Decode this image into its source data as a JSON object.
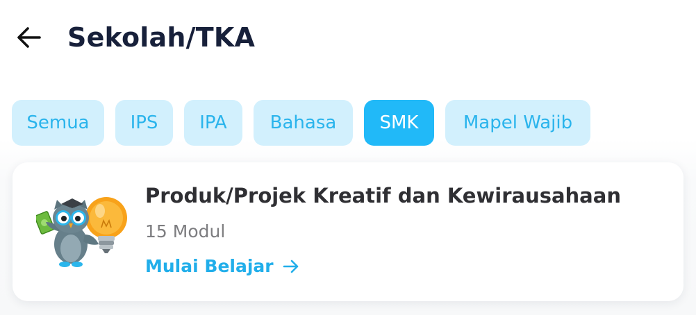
{
  "header": {
    "title": "Sekolah/TKA",
    "back_icon": "arrow-left-icon"
  },
  "filters": {
    "items": [
      {
        "label": "Semua",
        "active": false
      },
      {
        "label": "IPS",
        "active": false
      },
      {
        "label": "IPA",
        "active": false
      },
      {
        "label": "Bahasa",
        "active": false
      },
      {
        "label": "SMK",
        "active": true
      },
      {
        "label": "Mapel Wajib",
        "active": false
      }
    ]
  },
  "course": {
    "title": "Produk/Projek Kreatif dan Kewirausahaan",
    "modules": "15 Modul",
    "cta_label": "Mulai Belajar",
    "cta_icon": "arrow-right-icon",
    "illustration": "owl-lightbulb-money-illustration"
  },
  "colors": {
    "accent": "#21b9f8",
    "chip_bg": "#d2f0fd",
    "chip_text": "#2ab4ec",
    "title_text": "#17203a",
    "card_title": "#2f2f33",
    "meta_text": "#7d7d80",
    "cta_text": "#21aeea"
  }
}
